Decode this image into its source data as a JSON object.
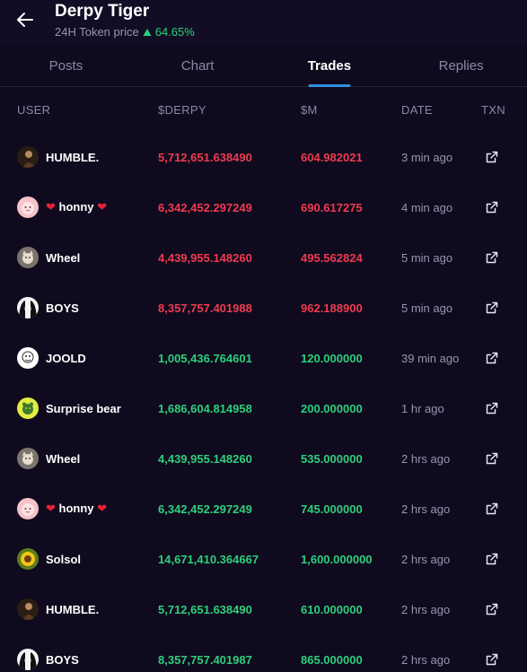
{
  "header": {
    "title": "Derpy Tiger",
    "price_label": "24H Token price",
    "price_change": "64.65%"
  },
  "tabs": [
    {
      "label": "Posts",
      "active": false
    },
    {
      "label": "Chart",
      "active": false
    },
    {
      "label": "Trades",
      "active": true
    },
    {
      "label": "Replies",
      "active": false
    }
  ],
  "columns": {
    "user": "USER",
    "derpy": "$DERPY",
    "m": "$M",
    "date": "DATE",
    "txn": "TXN"
  },
  "colors": {
    "sell": "#ef3b4f",
    "buy": "#2ecf7c",
    "accent": "#2f8fdf"
  },
  "trades": [
    {
      "user": "HUMBLE.",
      "amount": "5,712,651.638490",
      "m": "604.982021",
      "date": "3 min ago",
      "side": "sell",
      "avatar": "dark-figure",
      "hearts": false
    },
    {
      "user": "honny",
      "amount": "6,342,452.297249",
      "m": "690.617275",
      "date": "4 min ago",
      "side": "sell",
      "avatar": "pink-face",
      "hearts": true
    },
    {
      "user": "Wheel",
      "amount": "4,439,955.148260",
      "m": "495.562824",
      "date": "5 min ago",
      "side": "sell",
      "avatar": "cat-photo",
      "hearts": false
    },
    {
      "user": "BOYS",
      "amount": "8,357,757.401988",
      "m": "962.188900",
      "date": "5 min ago",
      "side": "sell",
      "avatar": "bw-hair",
      "hearts": false
    },
    {
      "user": "JOOLD",
      "amount": "1,005,436.764601",
      "m": "120.000000",
      "date": "39 min ago",
      "side": "buy",
      "avatar": "sketch",
      "hearts": false
    },
    {
      "user": "Surprise bear",
      "amount": "1,686,604.814958",
      "m": "200.000000",
      "date": "1 hr ago",
      "side": "buy",
      "avatar": "yellow-bear",
      "hearts": false
    },
    {
      "user": "Wheel",
      "amount": "4,439,955.148260",
      "m": "535.000000",
      "date": "2 hrs ago",
      "side": "buy",
      "avatar": "cat-photo",
      "hearts": false
    },
    {
      "user": "honny",
      "amount": "6,342,452.297249",
      "m": "745.000000",
      "date": "2 hrs ago",
      "side": "buy",
      "avatar": "pink-face",
      "hearts": true
    },
    {
      "user": "Solsol",
      "amount": "14,671,410.364667",
      "m": "1,600.000000",
      "date": "2 hrs ago",
      "side": "buy",
      "avatar": "sunflower",
      "hearts": false
    },
    {
      "user": "HUMBLE.",
      "amount": "5,712,651.638490",
      "m": "610.000000",
      "date": "2 hrs ago",
      "side": "buy",
      "avatar": "dark-figure",
      "hearts": false
    },
    {
      "user": "BOYS",
      "amount": "8,357,757.401987",
      "m": "865.000000",
      "date": "2 hrs ago",
      "side": "buy",
      "avatar": "bw-hair",
      "hearts": false
    }
  ]
}
